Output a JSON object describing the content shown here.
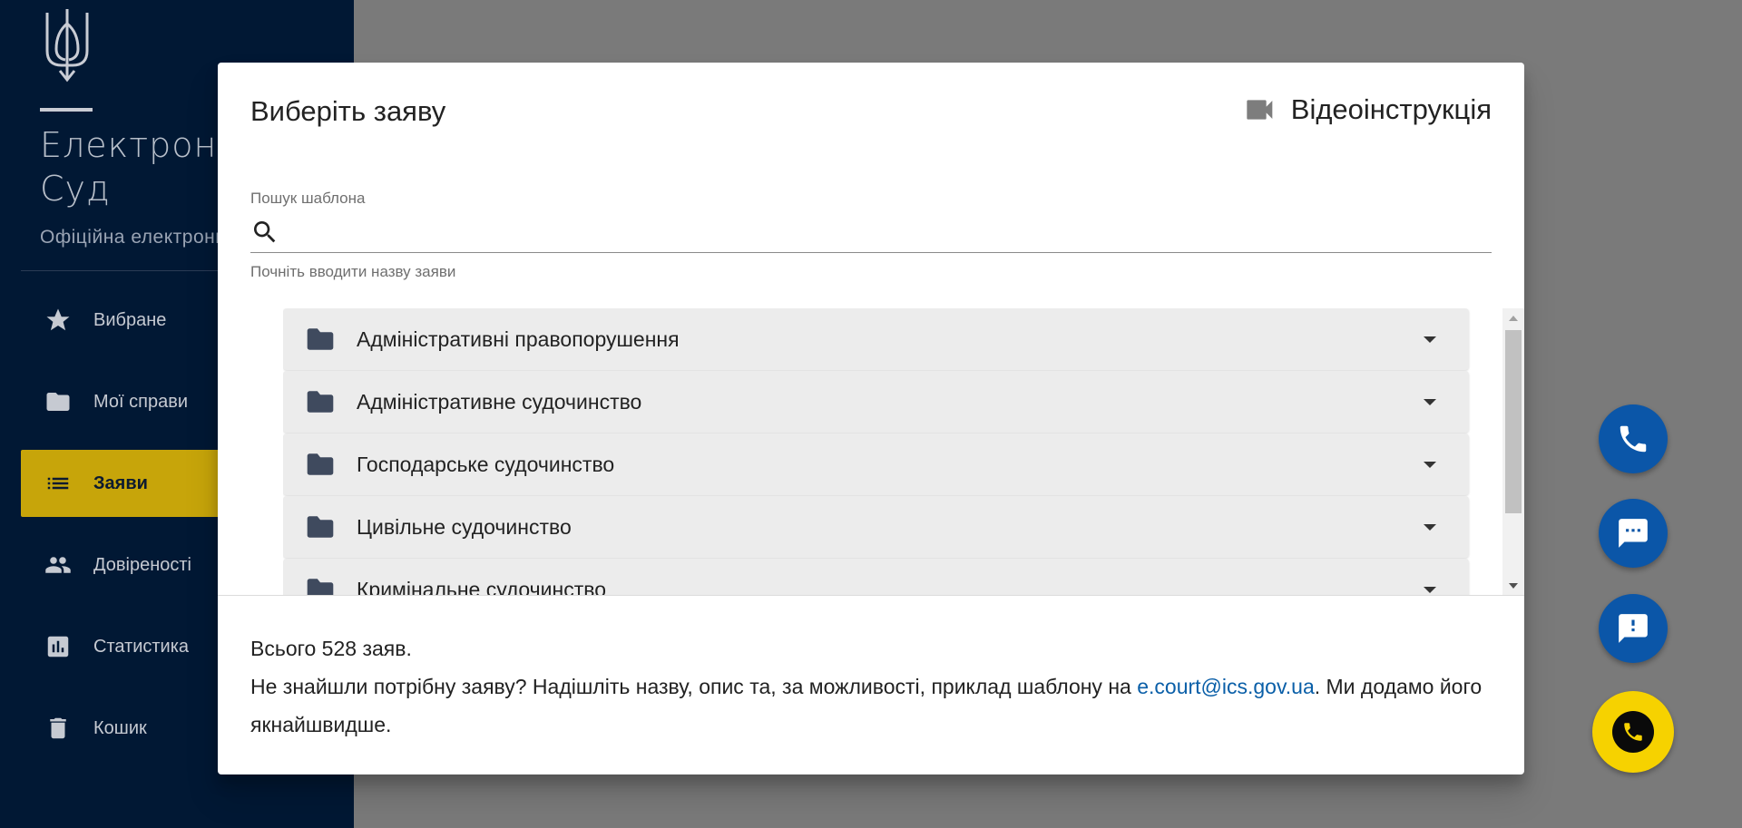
{
  "sidebar": {
    "brand_title": "Електронний\nСуд",
    "brand_subtitle": "Офіційна електронна",
    "items": [
      {
        "label": "Вибране",
        "icon": "star-icon"
      },
      {
        "label": "Мої справи",
        "icon": "folder-icon"
      },
      {
        "label": "Заяви",
        "icon": "list-icon",
        "active": true
      },
      {
        "label": "Довіреності",
        "icon": "people-icon"
      },
      {
        "label": "Статистика",
        "icon": "bar-chart-icon"
      },
      {
        "label": "Кошик",
        "icon": "trash-icon"
      }
    ]
  },
  "dialog": {
    "title": "Виберіть заяву",
    "video_label": "Відеоінструкція",
    "search": {
      "label": "Пошук шаблона",
      "value": "",
      "placeholder": "",
      "hint": "Почніть вводити назву заяви"
    },
    "categories": [
      {
        "label": "Адміністративні правопорушення"
      },
      {
        "label": "Адміністративне судочинство"
      },
      {
        "label": "Господарське судочинство"
      },
      {
        "label": "Цивільне судочинство"
      },
      {
        "label": "Кримінальне судочинство"
      }
    ],
    "footer": {
      "total": "Всього 528 заяв.",
      "missing_text": "Не знайшли потрібну заяву? Надішліть назву, опис та, за можливості, приклад шаблону на ",
      "email": "e.court@ics.gov.ua",
      "missing_tail": ". Ми додамо його якнайшвидше."
    }
  },
  "fabs": [
    {
      "name": "phone-fab",
      "icon": "phone-icon",
      "color": "#0b56a8"
    },
    {
      "name": "chat-fab",
      "icon": "chat-icon",
      "color": "#0b56a8"
    },
    {
      "name": "feedback-fab",
      "icon": "feedback-icon",
      "color": "#0b56a8"
    },
    {
      "name": "hotline-fab",
      "icon": "phone-circle-icon",
      "color": "#f6d200"
    }
  ],
  "colors": {
    "sidebar_bg": "#011834",
    "active_item": "#c7a50a",
    "link": "#0a5fa8",
    "overlay": "#7a7a7a"
  }
}
